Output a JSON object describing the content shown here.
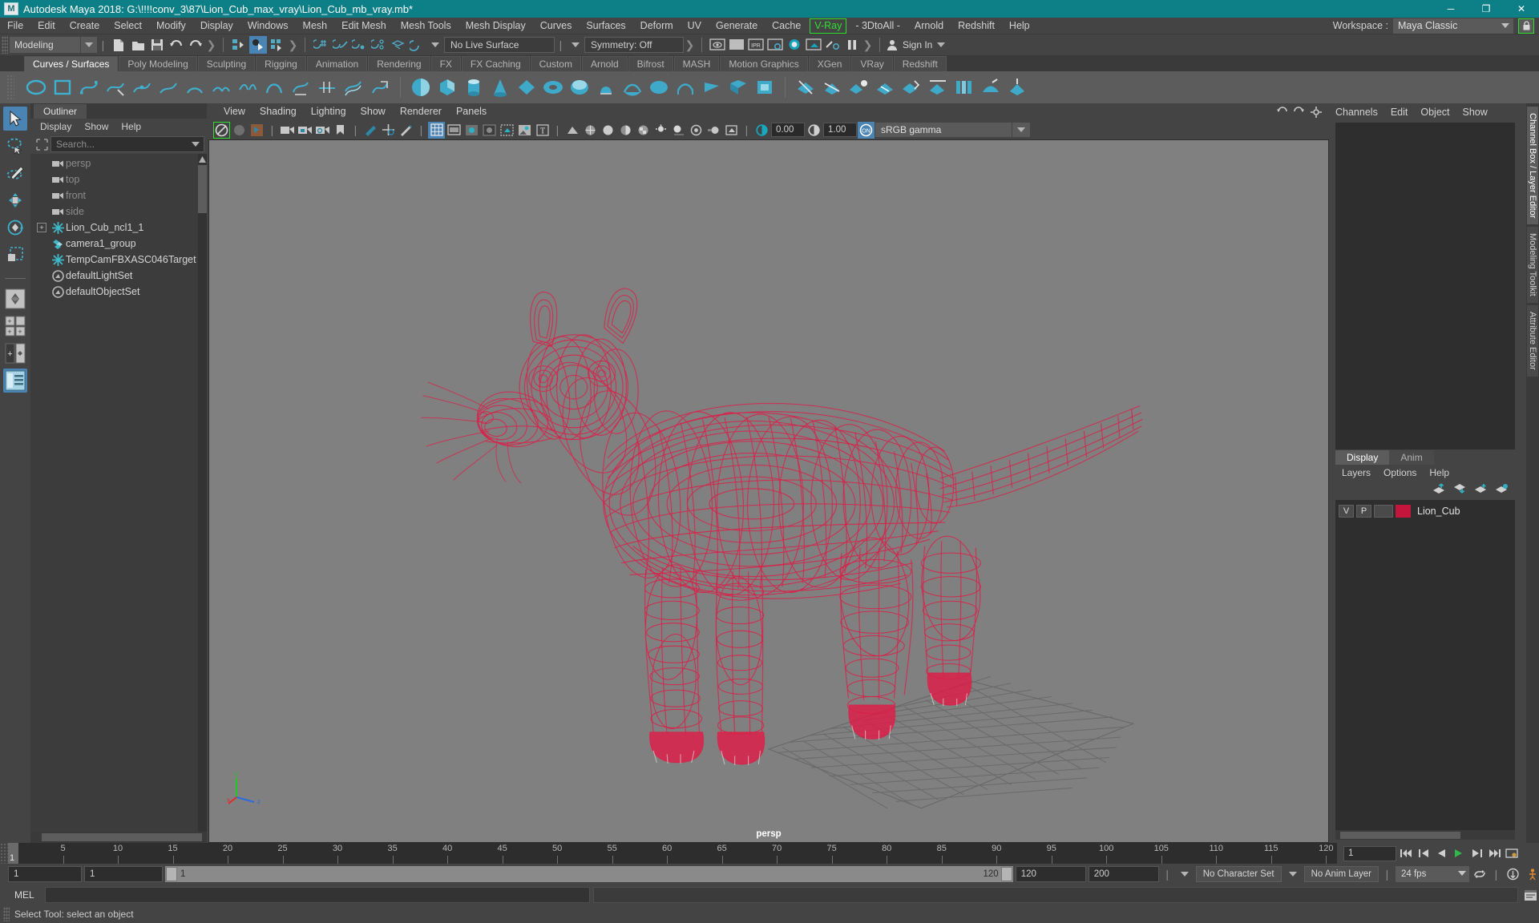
{
  "window": {
    "title": "Autodesk Maya 2018: G:\\!!!!conv_3\\87\\Lion_Cub_max_vray\\Lion_Cub_mb_vray.mb*",
    "logo": "M",
    "minimize": "─",
    "maximize": "❐",
    "close": "✕"
  },
  "menubar": {
    "items": [
      {
        "label": "File"
      },
      {
        "label": "Edit"
      },
      {
        "label": "Create"
      },
      {
        "label": "Select"
      },
      {
        "label": "Modify"
      },
      {
        "label": "Display"
      },
      {
        "label": "Windows"
      },
      {
        "label": "Mesh"
      },
      {
        "label": "Edit Mesh"
      },
      {
        "label": "Mesh Tools"
      },
      {
        "label": "Mesh Display"
      },
      {
        "label": "Curves"
      },
      {
        "label": "Surfaces"
      },
      {
        "label": "Deform"
      },
      {
        "label": "UV"
      },
      {
        "label": "Generate"
      },
      {
        "label": "Cache"
      },
      {
        "label": "V-Ray",
        "highlight": true
      },
      {
        "label": "- 3DtoAll -"
      },
      {
        "label": "Arnold"
      },
      {
        "label": "Redshift"
      },
      {
        "label": "Help"
      }
    ],
    "workspace_label": "Workspace :",
    "workspace_value": "Maya Classic",
    "lock_icon": "lock-icon"
  },
  "statusline": {
    "mode": "Modeling",
    "live_surface": "No Live Surface",
    "symmetry": "Symmetry: Off",
    "signin": "Sign In"
  },
  "shelf": {
    "tabs": [
      {
        "label": "Curves / Surfaces",
        "active": true
      },
      {
        "label": "Poly Modeling",
        "active": false
      },
      {
        "label": "Sculpting",
        "active": false
      },
      {
        "label": "Rigging",
        "active": false
      },
      {
        "label": "Animation",
        "active": false
      },
      {
        "label": "Rendering",
        "active": false
      },
      {
        "label": "FX",
        "active": false
      },
      {
        "label": "FX Caching",
        "active": false
      },
      {
        "label": "Custom",
        "active": false
      },
      {
        "label": "Arnold",
        "active": false
      },
      {
        "label": "Bifrost",
        "active": false
      },
      {
        "label": "MASH",
        "active": false
      },
      {
        "label": "Motion Graphics",
        "active": false
      },
      {
        "label": "XGen",
        "active": false
      },
      {
        "label": "VRay",
        "active": false
      },
      {
        "label": "Redshift",
        "active": false
      }
    ]
  },
  "outliner": {
    "tab": "Outliner",
    "menus": [
      "Display",
      "Show",
      "Help"
    ],
    "search_placeholder": "Search...",
    "items": [
      {
        "label": "persp",
        "icon": "camera-icon",
        "dim": true,
        "expandable": false
      },
      {
        "label": "top",
        "icon": "camera-icon",
        "dim": true,
        "expandable": false
      },
      {
        "label": "front",
        "icon": "camera-icon",
        "dim": true,
        "expandable": false
      },
      {
        "label": "side",
        "icon": "camera-icon",
        "dim": true,
        "expandable": false
      },
      {
        "label": "Lion_Cub_ncl1_1",
        "icon": "transform-icon",
        "dim": false,
        "expandable": true
      },
      {
        "label": "camera1_group",
        "icon": "group-icon",
        "dim": false,
        "expandable": false
      },
      {
        "label": "TempCamFBXASC046Target",
        "icon": "transform-icon",
        "dim": false,
        "expandable": false
      },
      {
        "label": "defaultLightSet",
        "icon": "set-icon",
        "dim": false,
        "expandable": false
      },
      {
        "label": "defaultObjectSet",
        "icon": "set-icon",
        "dim": false,
        "expandable": false
      }
    ]
  },
  "viewport": {
    "menus": [
      "View",
      "Shading",
      "Lighting",
      "Show",
      "Renderer",
      "Panels"
    ],
    "exposure": "0.00",
    "gamma": "1.00",
    "color_space": "sRGB gamma",
    "camera_label": "persp",
    "axis": {
      "x": "x",
      "y": "y",
      "z": "z"
    },
    "model_color": "#e01b46",
    "background": "#808080"
  },
  "rightpanel": {
    "channel_tabs": [
      "Channels",
      "Edit",
      "Object",
      "Show"
    ],
    "layer_tabs": [
      {
        "label": "Display",
        "active": true
      },
      {
        "label": "Anim",
        "active": false
      }
    ],
    "layer_menus": [
      "Layers",
      "Options",
      "Help"
    ],
    "layers": [
      {
        "v": "V",
        "p": "P",
        "color": "#c4163c",
        "name": "Lion_Cub"
      }
    ],
    "vertical_tabs": [
      {
        "label": "Channel Box / Layer Editor",
        "active": true
      },
      {
        "label": "Modeling Toolkit",
        "active": false
      },
      {
        "label": "Attribute Editor",
        "active": false
      }
    ]
  },
  "timeline": {
    "current_frame": "1",
    "ticks": [
      5,
      10,
      15,
      20,
      25,
      30,
      35,
      40,
      45,
      50,
      55,
      60,
      65,
      70,
      75,
      80,
      85,
      90,
      95,
      100,
      105,
      110,
      115,
      120
    ],
    "frame_field": "1",
    "range_start": "1",
    "range_start2": "1",
    "range_bar_start": "1",
    "range_bar_end": "120",
    "range_end": "120",
    "range_max": "200",
    "character_set": "No Character Set",
    "anim_layer": "No Anim Layer",
    "fps": "24 fps"
  },
  "command": {
    "mel_label": "MEL",
    "mel_value": ""
  },
  "status": {
    "message": "Select Tool: select an object"
  }
}
